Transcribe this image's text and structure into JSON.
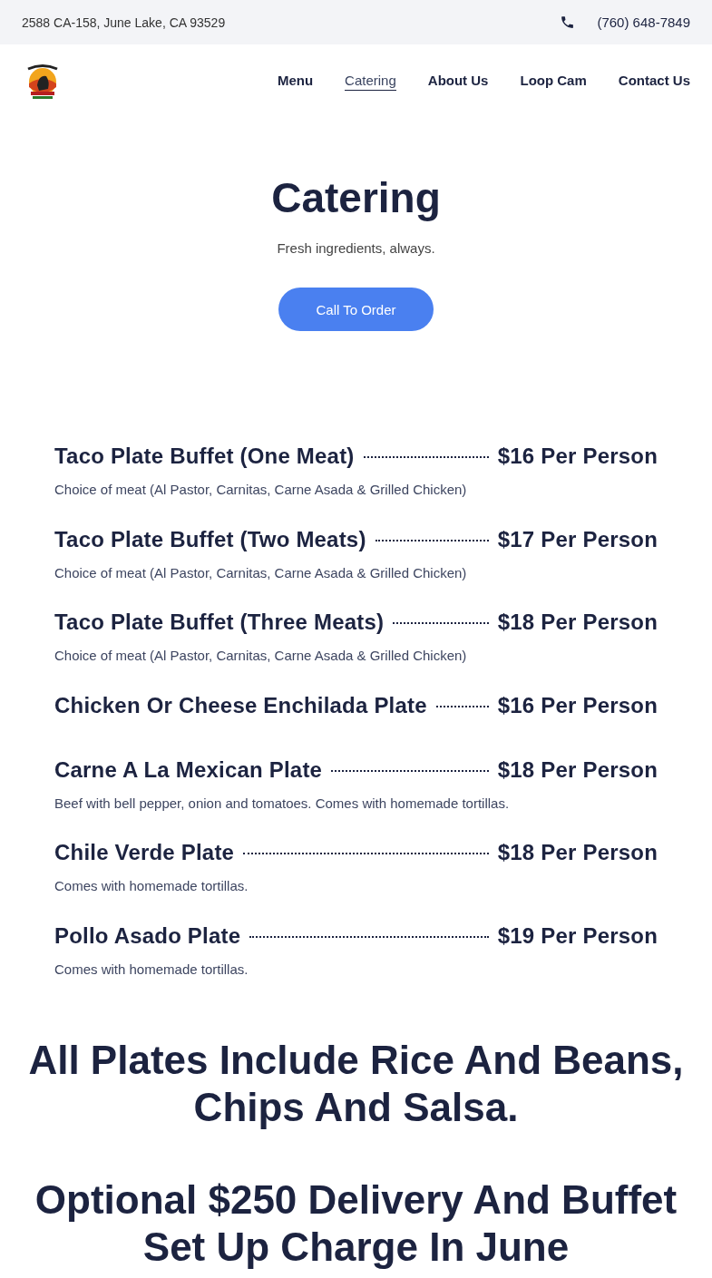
{
  "top_bar": {
    "address": "2588 CA-158, June Lake, CA 93529",
    "phone": "(760) 648-7849"
  },
  "nav": {
    "items": [
      {
        "label": "Menu",
        "selected": false
      },
      {
        "label": "Catering",
        "selected": true
      },
      {
        "label": "About Us",
        "selected": false
      },
      {
        "label": "Loop Cam",
        "selected": false
      },
      {
        "label": "Contact Us",
        "selected": false
      }
    ]
  },
  "hero": {
    "title": "Catering",
    "subtitle": "Fresh ingredients, always.",
    "button": "Call To Order"
  },
  "menu_items": [
    {
      "name": "Taco Plate Buffet (One Meat)",
      "price": "$16 Per Person",
      "description": "Choice of meat (Al Pastor, Carnitas, Carne Asada & Grilled Chicken)"
    },
    {
      "name": "Taco Plate Buffet (Two Meats)",
      "price": "$17 Per Person",
      "description": "Choice of meat (Al Pastor, Carnitas, Carne Asada & Grilled Chicken)"
    },
    {
      "name": "Taco Plate Buffet (Three Meats)",
      "price": "$18 Per Person",
      "description": "Choice of meat (Al Pastor, Carnitas, Carne Asada & Grilled Chicken)"
    },
    {
      "name": "Chicken Or Cheese Enchilada Plate",
      "price": "$16 Per Person"
    },
    {
      "name": "Carne A La Mexican Plate",
      "price": "$18 Per Person",
      "description": "Beef with bell pepper, onion and tomatoes. Comes with homemade tortillas."
    },
    {
      "name": "Chile Verde Plate",
      "price": "$18 Per Person",
      "description": "Comes with homemade tortillas."
    },
    {
      "name": "Pollo Asado Plate",
      "price": "$19 Per Person",
      "description": "Comes with homemade tortillas."
    }
  ],
  "notes": [
    "All Plates Include Rice And Beans, Chips And Salsa.",
    "Optional $250 Delivery And Buffet Set Up Charge In June"
  ]
}
